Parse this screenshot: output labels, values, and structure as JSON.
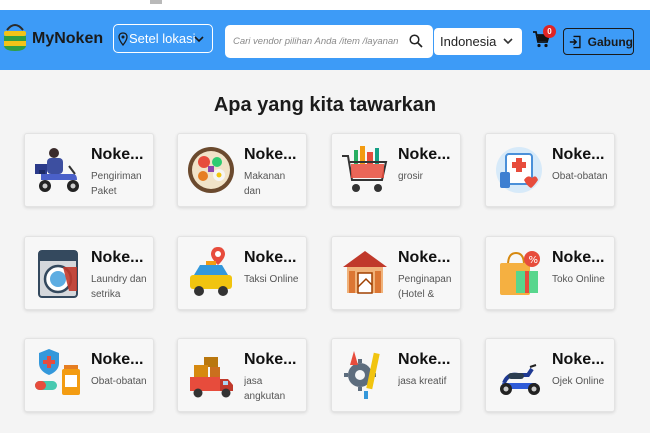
{
  "header": {
    "brand": "MyNoken",
    "location_label": "Setel lokasi",
    "search_placeholder": "Cari vendor pilihan Anda /item /layanan",
    "language": "Indonesia",
    "cart_count": "0",
    "join_label": "Gabung"
  },
  "main": {
    "heading": "Apa yang kita tawarkan",
    "services": [
      {
        "title": "Noke...",
        "desc": "Pengiriman Paket",
        "icon": "delivery-scooter-icon"
      },
      {
        "title": "Noke...",
        "desc": "Makanan dan Minuman",
        "icon": "food-plate-icon"
      },
      {
        "title": "Noke...",
        "desc": "grosir",
        "icon": "grocery-cart-icon"
      },
      {
        "title": "Noke...",
        "desc": "Obat-obatan",
        "icon": "medical-kit-icon"
      },
      {
        "title": "Noke...",
        "desc": "Laundry dan setrika",
        "icon": "washing-machine-icon"
      },
      {
        "title": "Noke...",
        "desc": "Taksi Online",
        "icon": "taxi-icon"
      },
      {
        "title": "Noke...",
        "desc": "Penginapan (Hotel & Villa)",
        "icon": "lodging-house-icon"
      },
      {
        "title": "Noke...",
        "desc": "Toko Online",
        "icon": "shopping-bag-icon"
      },
      {
        "title": "Noke...",
        "desc": "Obat-obatan",
        "icon": "medicine-bottle-icon"
      },
      {
        "title": "Noke...",
        "desc": "jasa angkutan",
        "icon": "moving-truck-icon"
      },
      {
        "title": "Noke...",
        "desc": "jasa kreatif",
        "icon": "creative-tools-icon"
      },
      {
        "title": "Noke...",
        "desc": "Ojek Online",
        "icon": "motorbike-icon"
      }
    ]
  },
  "colors": {
    "navbar": "#3d9bf7",
    "background": "#f4f4f4",
    "badge": "#e02424"
  }
}
